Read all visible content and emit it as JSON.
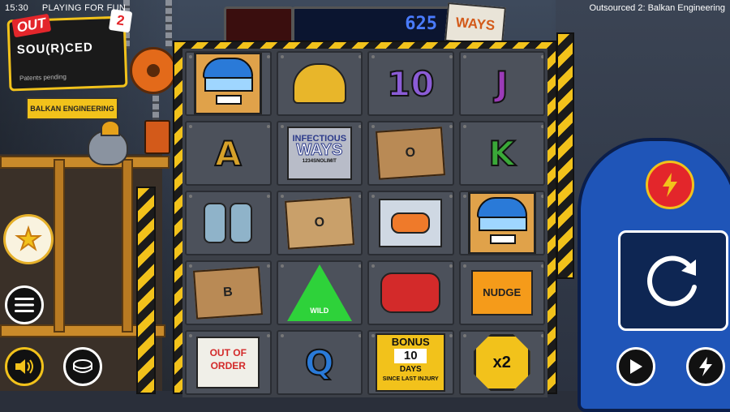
{
  "status": {
    "time": "15:30",
    "mode": "PLAYING FOR FUN",
    "game_title": "Outsourced 2: Balkan Engineering"
  },
  "logo": {
    "out": "OUT",
    "sourced": "SOU(R)CED",
    "number": "2",
    "patent": "Patents pending",
    "subtitle": "BALKAN ENGINEERING"
  },
  "header": {
    "ways_count": "625",
    "ways_label": "WAYS"
  },
  "reels": [
    [
      {
        "symbol": "worker-face"
      },
      {
        "symbol": "helmet"
      },
      {
        "symbol": "10",
        "label": "10"
      },
      {
        "symbol": "J",
        "label": "J"
      }
    ],
    [
      {
        "symbol": "A",
        "label": "A"
      },
      {
        "symbol": "infectious-ways",
        "label": "INFECTIOUS",
        "label2": "WAYS",
        "label3": "1234SNOLIMIT"
      },
      {
        "symbol": "box-o",
        "label": "O"
      },
      {
        "symbol": "K",
        "label": "K"
      }
    ],
    [
      {
        "symbol": "cans"
      },
      {
        "symbol": "box-o",
        "label": "O"
      },
      {
        "symbol": "glove"
      },
      {
        "symbol": "worker-face"
      }
    ],
    [
      {
        "symbol": "box-b",
        "label": "B"
      },
      {
        "symbol": "wild",
        "label": "WILD"
      },
      {
        "symbol": "gamepad"
      },
      {
        "symbol": "nudge",
        "label": "NUDGE"
      }
    ],
    [
      {
        "symbol": "out-of-order",
        "label": "OUT OF ORDER"
      },
      {
        "symbol": "Q",
        "label": "Q"
      },
      {
        "symbol": "bonus",
        "label": "BONUS",
        "number": "10",
        "days": "DAYS",
        "since": "SINCE LAST INJURY"
      },
      {
        "symbol": "x2",
        "label": "x2"
      }
    ]
  ],
  "colors": {
    "accent": "#f2c21b",
    "danger": "#e3262b",
    "counter": "#4a7cff"
  },
  "controls": {
    "favorite": "star-icon",
    "menu": "menu-icon",
    "sound": "speaker-icon",
    "bet": "coins-icon",
    "feature": "bolt-icon",
    "spin": "spin-arrow-icon",
    "autoplay": "play-icon",
    "turbo": "bolt-icon"
  }
}
